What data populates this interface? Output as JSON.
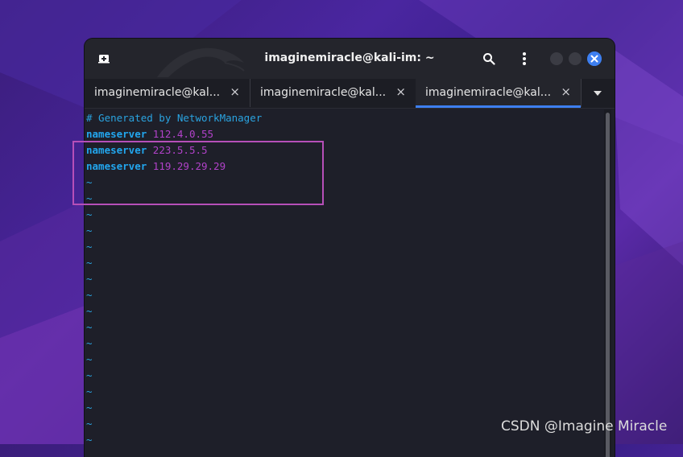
{
  "window": {
    "title": "imaginemiracle@kali-im: ~"
  },
  "tabs": [
    {
      "label": "imaginemiracle@kal...",
      "close": "×",
      "active": false
    },
    {
      "label": "imaginemiracle@kal...",
      "close": "×",
      "active": false
    },
    {
      "label": "imaginemiracle@kal...",
      "close": "×",
      "active": true
    }
  ],
  "terminal": {
    "comment": "# Generated by NetworkManager",
    "entries": [
      {
        "keyword": "nameserver",
        "value": "112.4.0.55"
      },
      {
        "keyword": "nameserver",
        "value": "223.5.5.5"
      },
      {
        "keyword": "nameserver",
        "value": "119.29.29.29"
      }
    ],
    "empty_line_marker": "~"
  },
  "icons": {
    "new_tab": "new-tab-icon",
    "search": "search-icon",
    "menu": "kebab-menu-icon",
    "close": "close-icon",
    "dropdown": "chevron-down-icon"
  },
  "colors": {
    "accent": "#3d7ff0",
    "keyword": "#22a6ee",
    "value": "#b142c9",
    "highlight_box": "#b64fb8"
  },
  "watermark": "CSDN @Imagine Miracle"
}
